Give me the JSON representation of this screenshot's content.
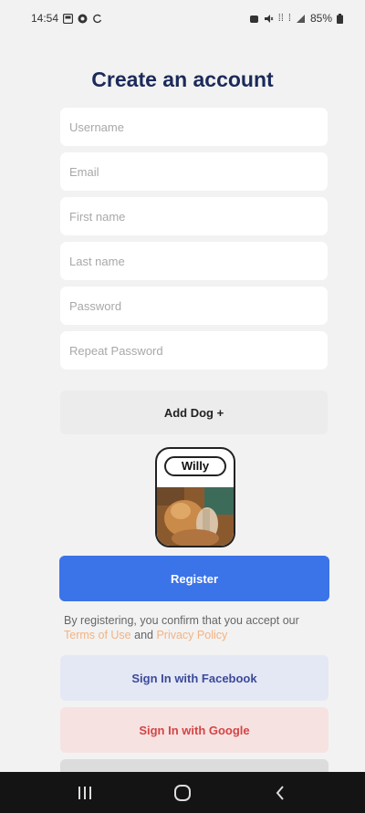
{
  "status_bar": {
    "time": "14:54",
    "battery": "85%"
  },
  "title": "Create an account",
  "form": {
    "username_placeholder": "Username",
    "email_placeholder": "Email",
    "first_name_placeholder": "First name",
    "last_name_placeholder": "Last name",
    "password_placeholder": "Password",
    "repeat_password_placeholder": "Repeat Password"
  },
  "add_dog_label": "Add Dog +",
  "dog_card": {
    "name": "Willy"
  },
  "register_label": "Register",
  "terms": {
    "prefix": "By registering, you confirm that you accept our ",
    "terms_link": "Terms of Use",
    "middle": " and ",
    "privacy_link": "Privacy Policy"
  },
  "facebook_label": "Sign In with Facebook",
  "google_label": "Sign In with Google",
  "colors": {
    "title": "#1b2a5a",
    "register": "#3b73e8",
    "link": "#f2b383",
    "facebook_bg": "#e4e7f4",
    "facebook_text": "#3b4a9a",
    "google_bg": "#f7e2e2",
    "google_text": "#d34545"
  },
  "nav_icons": [
    "recent-apps-icon",
    "home-icon",
    "back-icon"
  ]
}
